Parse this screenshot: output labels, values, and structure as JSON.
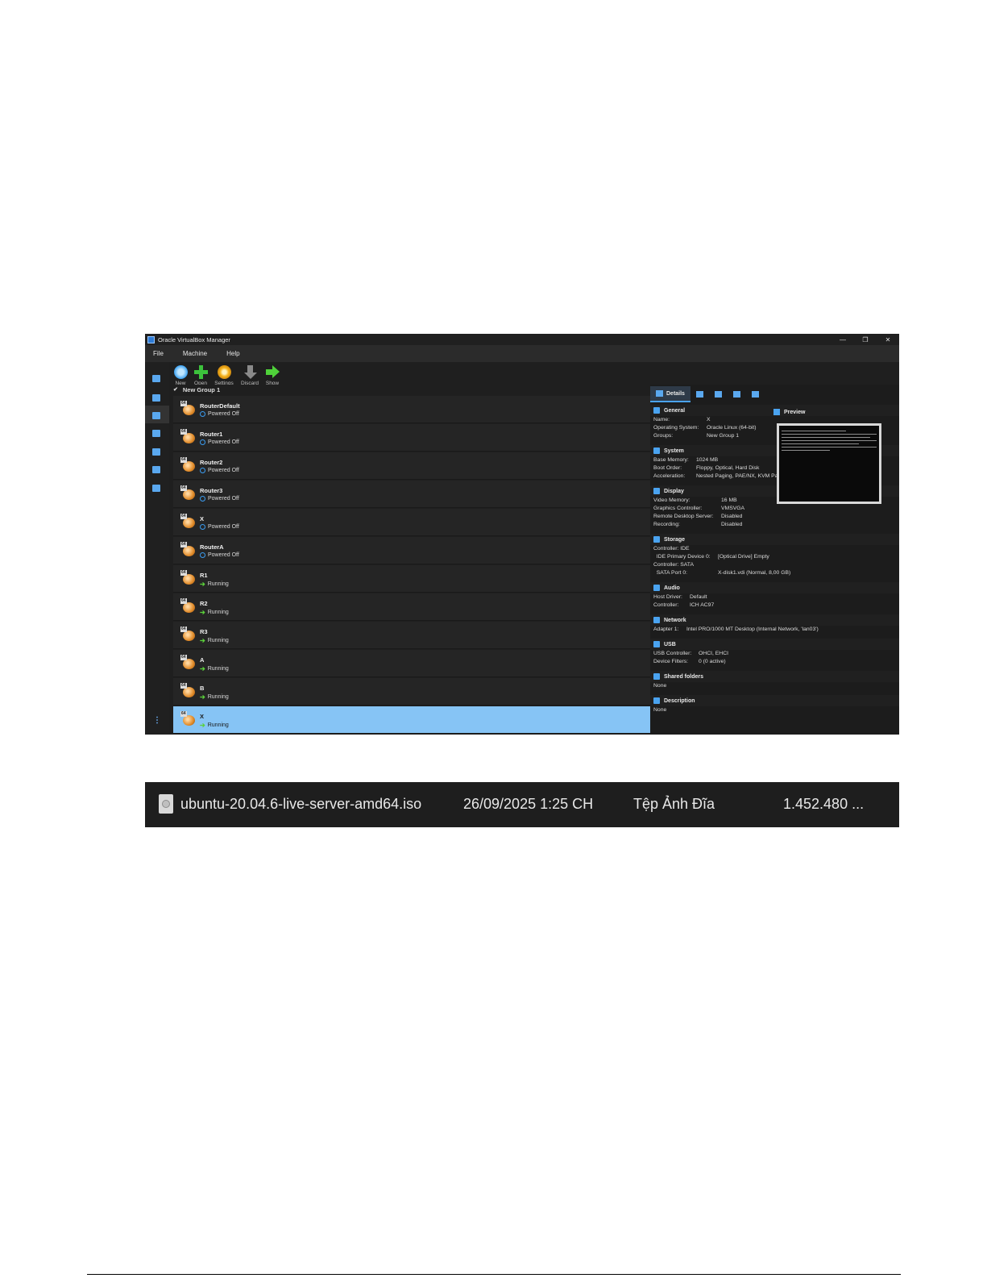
{
  "window": {
    "title": "Oracle VirtualBox Manager",
    "minimize": "—",
    "maximize": "❐",
    "close": "✕"
  },
  "menu": [
    "File",
    "Machine",
    "Help"
  ],
  "toolbar": {
    "new": "New",
    "open": "Open",
    "settings": "Settings",
    "discard": "Discard",
    "show": "Show"
  },
  "group": {
    "label": "New Group 1"
  },
  "vms": [
    {
      "name": "RouterDefault",
      "state": "Powered Off"
    },
    {
      "name": "Router1",
      "state": "Powered Off"
    },
    {
      "name": "Router2",
      "state": "Powered Off"
    },
    {
      "name": "Router3",
      "state": "Powered Off"
    },
    {
      "name": "X",
      "state": "Powered Off"
    },
    {
      "name": "RouterA",
      "state": "Powered Off"
    },
    {
      "name": "R1",
      "state": "Running"
    },
    {
      "name": "R2",
      "state": "Running"
    },
    {
      "name": "R3",
      "state": "Running"
    },
    {
      "name": "A",
      "state": "Running"
    },
    {
      "name": "B",
      "state": "Running"
    },
    {
      "name": "X",
      "state": "Running"
    }
  ],
  "os_badge": "64",
  "tabs": {
    "details": "Details"
  },
  "details": {
    "general": {
      "title": "General",
      "rows": [
        [
          "Name:",
          "X"
        ],
        [
          "Operating System:",
          "Oracle Linux (64-bit)"
        ],
        [
          "Groups:",
          "New Group 1"
        ]
      ]
    },
    "system": {
      "title": "System",
      "rows": [
        [
          "Base Memory:",
          "1024 MB"
        ],
        [
          "Boot Order:",
          "Floppy, Optical, Hard Disk"
        ],
        [
          "Acceleration:",
          "Nested Paging, PAE/NX, KVM Paravirtualization"
        ]
      ]
    },
    "display": {
      "title": "Display",
      "rows": [
        [
          "Video Memory:",
          "16 MB"
        ],
        [
          "Graphics Controller:",
          "VMSVGA"
        ],
        [
          "Remote Desktop Server:",
          "Disabled"
        ],
        [
          "Recording:",
          "Disabled"
        ]
      ]
    },
    "storage": {
      "title": "Storage",
      "rows": [
        [
          "Controller: IDE",
          ""
        ],
        [
          "  IDE Primary Device 0:",
          "[Optical Drive] Empty"
        ],
        [
          "Controller: SATA",
          ""
        ],
        [
          "  SATA Port 0:",
          "X-disk1.vdi (Normal, 8,00 GB)"
        ]
      ]
    },
    "audio": {
      "title": "Audio",
      "rows": [
        [
          "Host Driver:",
          "Default"
        ],
        [
          "Controller:",
          "ICH AC97"
        ]
      ]
    },
    "network": {
      "title": "Network",
      "rows": [
        [
          "Adapter 1:",
          "Intel PRO/1000 MT Desktop (Internal Network, 'lan03')"
        ]
      ]
    },
    "usb": {
      "title": "USB",
      "rows": [
        [
          "USB Controller:",
          "OHCI, EHCI"
        ],
        [
          "Device Filters:",
          "0 (0 active)"
        ]
      ]
    },
    "shared": {
      "title": "Shared folders",
      "rows": [
        [
          "None",
          ""
        ]
      ]
    },
    "description": {
      "title": "Description",
      "rows": [
        [
          "None",
          ""
        ]
      ]
    }
  },
  "preview": {
    "title": "Preview"
  },
  "file": {
    "name": "ubuntu-20.04.6-live-server-amd64.iso",
    "date": "26/09/2025 1:25 CH",
    "type": "Tệp Ảnh Đĩa",
    "size": "1.452.480 ..."
  },
  "colors": {
    "accent": "#4aa3f0",
    "selected_row": "#86c4f5",
    "running": "#5bd13b",
    "powered_off": "#3b9cf0"
  }
}
